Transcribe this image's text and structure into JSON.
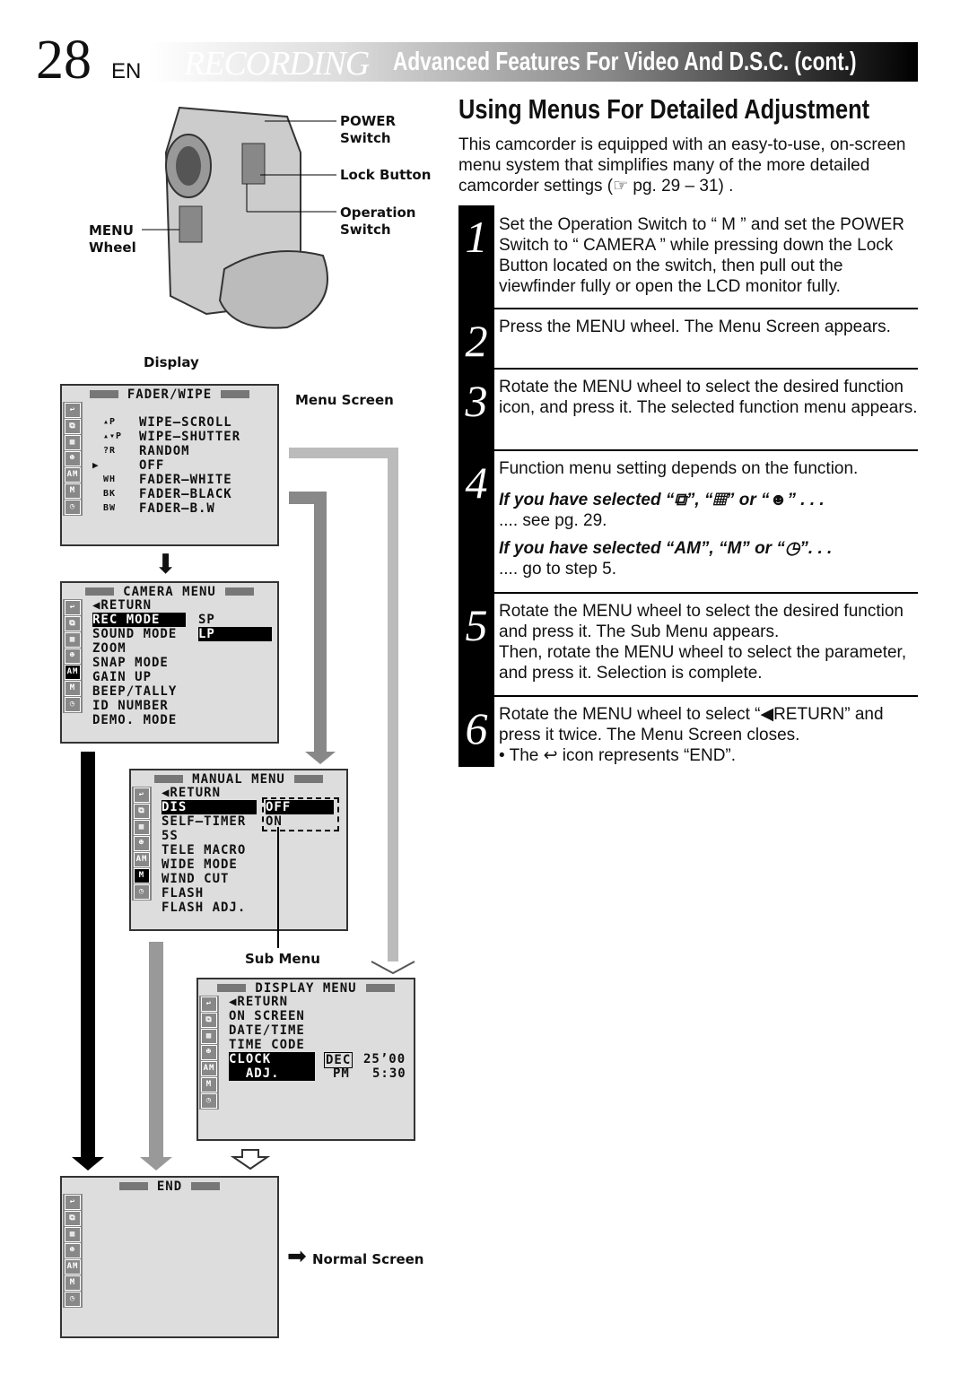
{
  "header": {
    "page_number": "28",
    "lang": "EN",
    "section": "RECORDING",
    "title": "Advanced Features For Video And D.S.C. (cont.)"
  },
  "diagram": {
    "labels": {
      "power": "POWER",
      "power2": "Switch",
      "lock": "Lock Button",
      "operation": "Operation",
      "operation2": "Switch",
      "menu": "MENU",
      "menu2": "Wheel",
      "display": "Display",
      "menu_screen": "Menu Screen",
      "sub_menu": "Sub Menu",
      "normal_screen": "Normal Screen"
    },
    "fader": {
      "title": "FADER/WIPE",
      "items": [
        [
          "▴P",
          "WIPE–SCROLL"
        ],
        [
          "▴▾P",
          "WIPE–SHUTTER"
        ],
        [
          "?R",
          "RANDOM"
        ],
        [
          "▶",
          "OFF"
        ],
        [
          "WH",
          "FADER–WHITE"
        ],
        [
          "BK",
          "FADER–BLACK"
        ],
        [
          "BW",
          "FADER–B.W"
        ]
      ]
    },
    "camera": {
      "title": "CAMERA  MENU",
      "items": [
        "◀RETURN",
        "REC  MODE",
        "SOUND  MODE",
        "ZOOM",
        "SNAP  MODE",
        "GAIN  UP",
        "BEEP/TALLY",
        " ID  NUMBER",
        "DEMO.  MODE"
      ],
      "opt1": "SP",
      "opt2": "LP"
    },
    "manual": {
      "title": "MANUAL  MENU",
      "items": [
        "◀RETURN",
        "DIS",
        "SELF–TIMER",
        "5S",
        "TELE  MACRO",
        "WIDE  MODE",
        "WIND  CUT",
        "FLASH",
        "FLASH  ADJ."
      ],
      "opt1": "OFF",
      "opt2": "ON"
    },
    "display": {
      "title": "DISPLAY  MENU",
      "items": [
        "◀RETURN",
        "ON  SCREEN",
        "DATE/TIME",
        "TIME  CODE",
        "CLOCK",
        "  ADJ."
      ],
      "date": "DEC",
      "date_val": "25’00",
      "pm": "PM",
      "time": "5:30"
    },
    "end": {
      "title": "END"
    },
    "side_icons": [
      "↩",
      "⧉",
      "▦",
      "☻",
      "AM",
      "M",
      "◷"
    ]
  },
  "content": {
    "heading": "Using Menus For Detailed Adjustment",
    "intro": "This camcorder is equipped with an easy-to-use, on-screen menu system that simplifies many of the more detailed camcorder settings (☞ pg. 29 – 31) .",
    "steps": [
      {
        "n": "1",
        "text": "Set the Operation Switch to “ M ” and set the POWER Switch to “ CAMERA ” while pressing down the Lock Button located on the switch, then pull out the viewfinder fully or open the LCD monitor fully."
      },
      {
        "n": "2",
        "text": "Press the MENU wheel. The Menu Screen appears."
      },
      {
        "n": "3",
        "text": "Rotate the MENU wheel to select the desired function icon, and press it. The selected function menu appears."
      },
      {
        "n": "4",
        "text": "Function menu setting depends on the function.",
        "sub1": "If you have selected “⧉”, “▦” or “☻” . . .",
        "sub1b": ".... see pg. 29.",
        "sub2": "If you have selected “AM”, “M” or “◷”. . .",
        "sub2b": ".... go to step 5."
      },
      {
        "n": "5",
        "text": "Rotate the MENU wheel to select the desired function and press it. The Sub Menu appears.",
        "text2": "Then, rotate the MENU wheel to select the parameter, and press it. Selection is complete."
      },
      {
        "n": "6",
        "text": "Rotate the MENU wheel to select “◀RETURN” and press it twice. The Menu Screen closes.",
        "bullet": "• The ↩ icon represents “END”."
      }
    ]
  }
}
